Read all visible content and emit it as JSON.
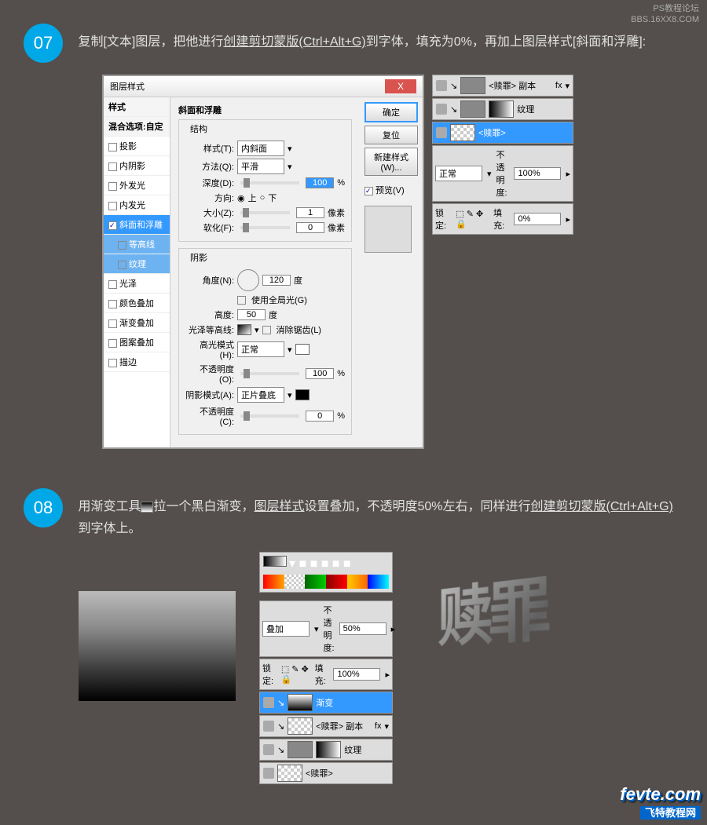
{
  "watermark": {
    "line1": "PS教程论坛",
    "line2": "BBS.16XX8.COM"
  },
  "step07": {
    "num": "07",
    "text_before": "复制[文本]图层，把他进行",
    "text_link1": "创建剪切蒙版(Ctrl+Alt+G)",
    "text_mid": "到字体，填充为0%，再加上图层样式[斜面和浮雕]:"
  },
  "dialog": {
    "title": "图层样式",
    "close": "X",
    "styles_header": "样式",
    "blend_header": "混合选项:自定",
    "items": [
      {
        "label": "投影",
        "checked": false
      },
      {
        "label": "内阴影",
        "checked": false
      },
      {
        "label": "外发光",
        "checked": false
      },
      {
        "label": "内发光",
        "checked": false
      },
      {
        "label": "斜面和浮雕",
        "checked": true,
        "selected": true
      },
      {
        "label": "等高线",
        "sub": true
      },
      {
        "label": "纹理",
        "sub": true
      },
      {
        "label": "光泽",
        "checked": false
      },
      {
        "label": "颜色叠加",
        "checked": false
      },
      {
        "label": "渐变叠加",
        "checked": false
      },
      {
        "label": "图案叠加",
        "checked": false
      },
      {
        "label": "描边",
        "checked": false
      }
    ],
    "section_title": "斜面和浮雕",
    "group_struct": "结构",
    "style_label": "样式(T):",
    "style_val": "内斜面",
    "method_label": "方法(Q):",
    "method_val": "平滑",
    "depth_label": "深度(D):",
    "depth_val": "100",
    "pct": "%",
    "dir_label": "方向:",
    "dir_up": "上",
    "dir_down": "下",
    "size_label": "大小(Z):",
    "size_val": "1",
    "px": "像素",
    "soft_label": "软化(F):",
    "soft_val": "0",
    "group_shadow": "阴影",
    "angle_label": "角度(N):",
    "angle_val": "120",
    "deg": "度",
    "global": "使用全局光(G)",
    "alt_label": "高度:",
    "alt_val": "50",
    "gloss_label": "光泽等高线:",
    "anti": "消除锯齿(L)",
    "hl_mode_label": "高光模式(H):",
    "hl_mode": "正常",
    "hl_op_label": "不透明度(O):",
    "hl_op": "100",
    "sh_mode_label": "阴影模式(A):",
    "sh_mode": "正片叠底",
    "sh_op_label": "不透明度(C):",
    "sh_op": "0",
    "btn_ok": "确定",
    "btn_cancel": "复位",
    "btn_new": "新建样式(W)...",
    "preview": "预览(V)"
  },
  "layers07": {
    "row1": "<赎罪> 副本",
    "row2": "纹理",
    "row3": "<赎罪>",
    "mode": "正常",
    "op_label": "不透明度:",
    "op": "100%",
    "lock": "锁定:",
    "fill_label": "填充:",
    "fill": "0%",
    "fx": "fx"
  },
  "step08": {
    "num": "08",
    "text_before": "用渐变工具",
    "text_mid": "拉一个黑白渐变，",
    "text_link": "图层样式",
    "text_after": "设置叠加，不透明度50%左右，同样进行",
    "text_link2": "创建剪切蒙版(Ctrl+Alt+G)",
    "text_end": "到字体上。"
  },
  "layers08": {
    "mode": "叠加",
    "op_label": "不透明度:",
    "op": "50%",
    "lock": "锁定:",
    "fill_label": "填充:",
    "fill": "100%",
    "row1": "渐变",
    "row2": "<赎罪> 副本",
    "row3": "纹理",
    "row4": "<赎罪>",
    "fx": "fx"
  },
  "footer": {
    "main": "fevte.com",
    "sub": "飞特教程网"
  }
}
